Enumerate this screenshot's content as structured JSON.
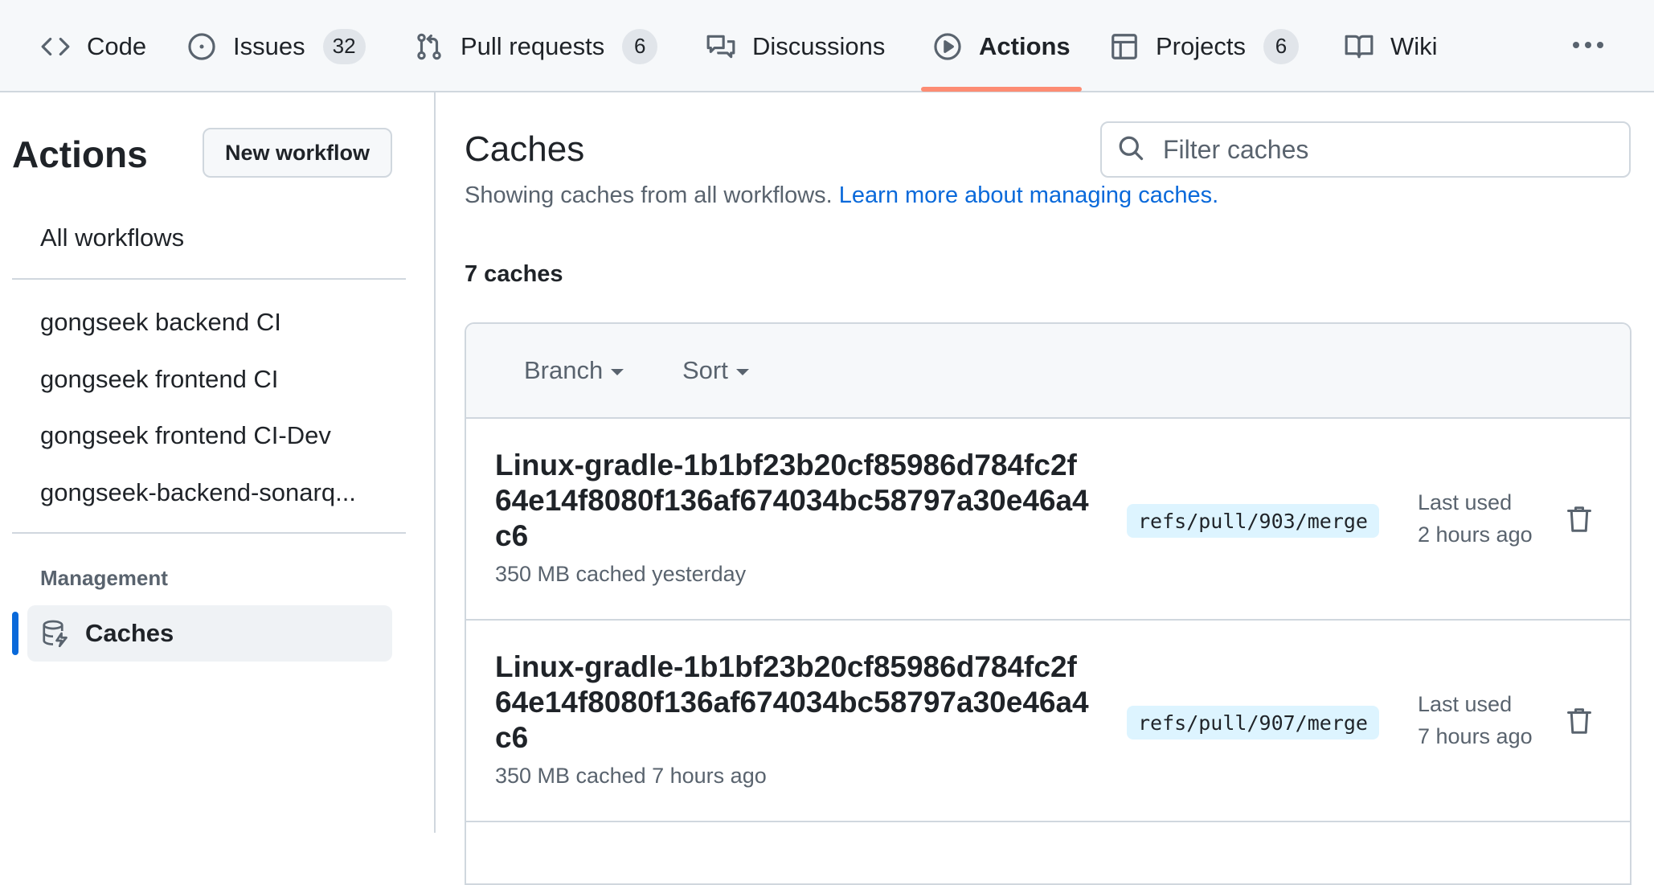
{
  "nav": {
    "tabs": [
      {
        "label": "Code",
        "icon": "code-icon"
      },
      {
        "label": "Issues",
        "icon": "issue-opened-icon",
        "counter": "32"
      },
      {
        "label": "Pull requests",
        "icon": "git-pull-request-icon",
        "counter": "6"
      },
      {
        "label": "Discussions",
        "icon": "comment-discussion-icon"
      },
      {
        "label": "Actions",
        "icon": "play-icon",
        "active": true
      },
      {
        "label": "Projects",
        "icon": "table-icon",
        "counter": "6"
      },
      {
        "label": "Wiki",
        "icon": "book-icon"
      }
    ],
    "more_icon": "kebab-horizontal-icon",
    "active_color": "#fd8c73"
  },
  "sidebar": {
    "title": "Actions",
    "new_workflow_label": "New workflow",
    "all_workflows_label": "All workflows",
    "workflows": [
      "gongseek backend CI",
      "gongseek frontend CI",
      "gongseek frontend CI-Dev",
      "gongseek-backend-sonarq..."
    ],
    "management_label": "Management",
    "active_item": {
      "label": "Caches",
      "icon": "database-icon"
    },
    "accent_color": "#0969da"
  },
  "main": {
    "title": "Caches",
    "filter_placeholder": "Filter caches",
    "subtitle": "Showing caches from all workflows.",
    "learn_more_link": "Learn more about managing caches.",
    "count_label": "7 caches",
    "branch_filter_label": "Branch",
    "sort_label": "Sort",
    "caches": [
      {
        "key": "Linux-gradle-1b1bf23b20cf85986d784fc2f64e14f8080f136af674034bc58797a30e46a4c6",
        "meta": "350 MB cached yesterday",
        "branch": "refs/pull/903/merge",
        "last_used_label": "Last used",
        "last_used_value": "2 hours ago"
      },
      {
        "key": "Linux-gradle-1b1bf23b20cf85986d784fc2f64e14f8080f136af674034bc58797a30e46a4c6",
        "meta": "350 MB cached 7 hours ago",
        "branch": "refs/pull/907/merge",
        "last_used_label": "Last used",
        "last_used_value": "7 hours ago"
      }
    ]
  }
}
